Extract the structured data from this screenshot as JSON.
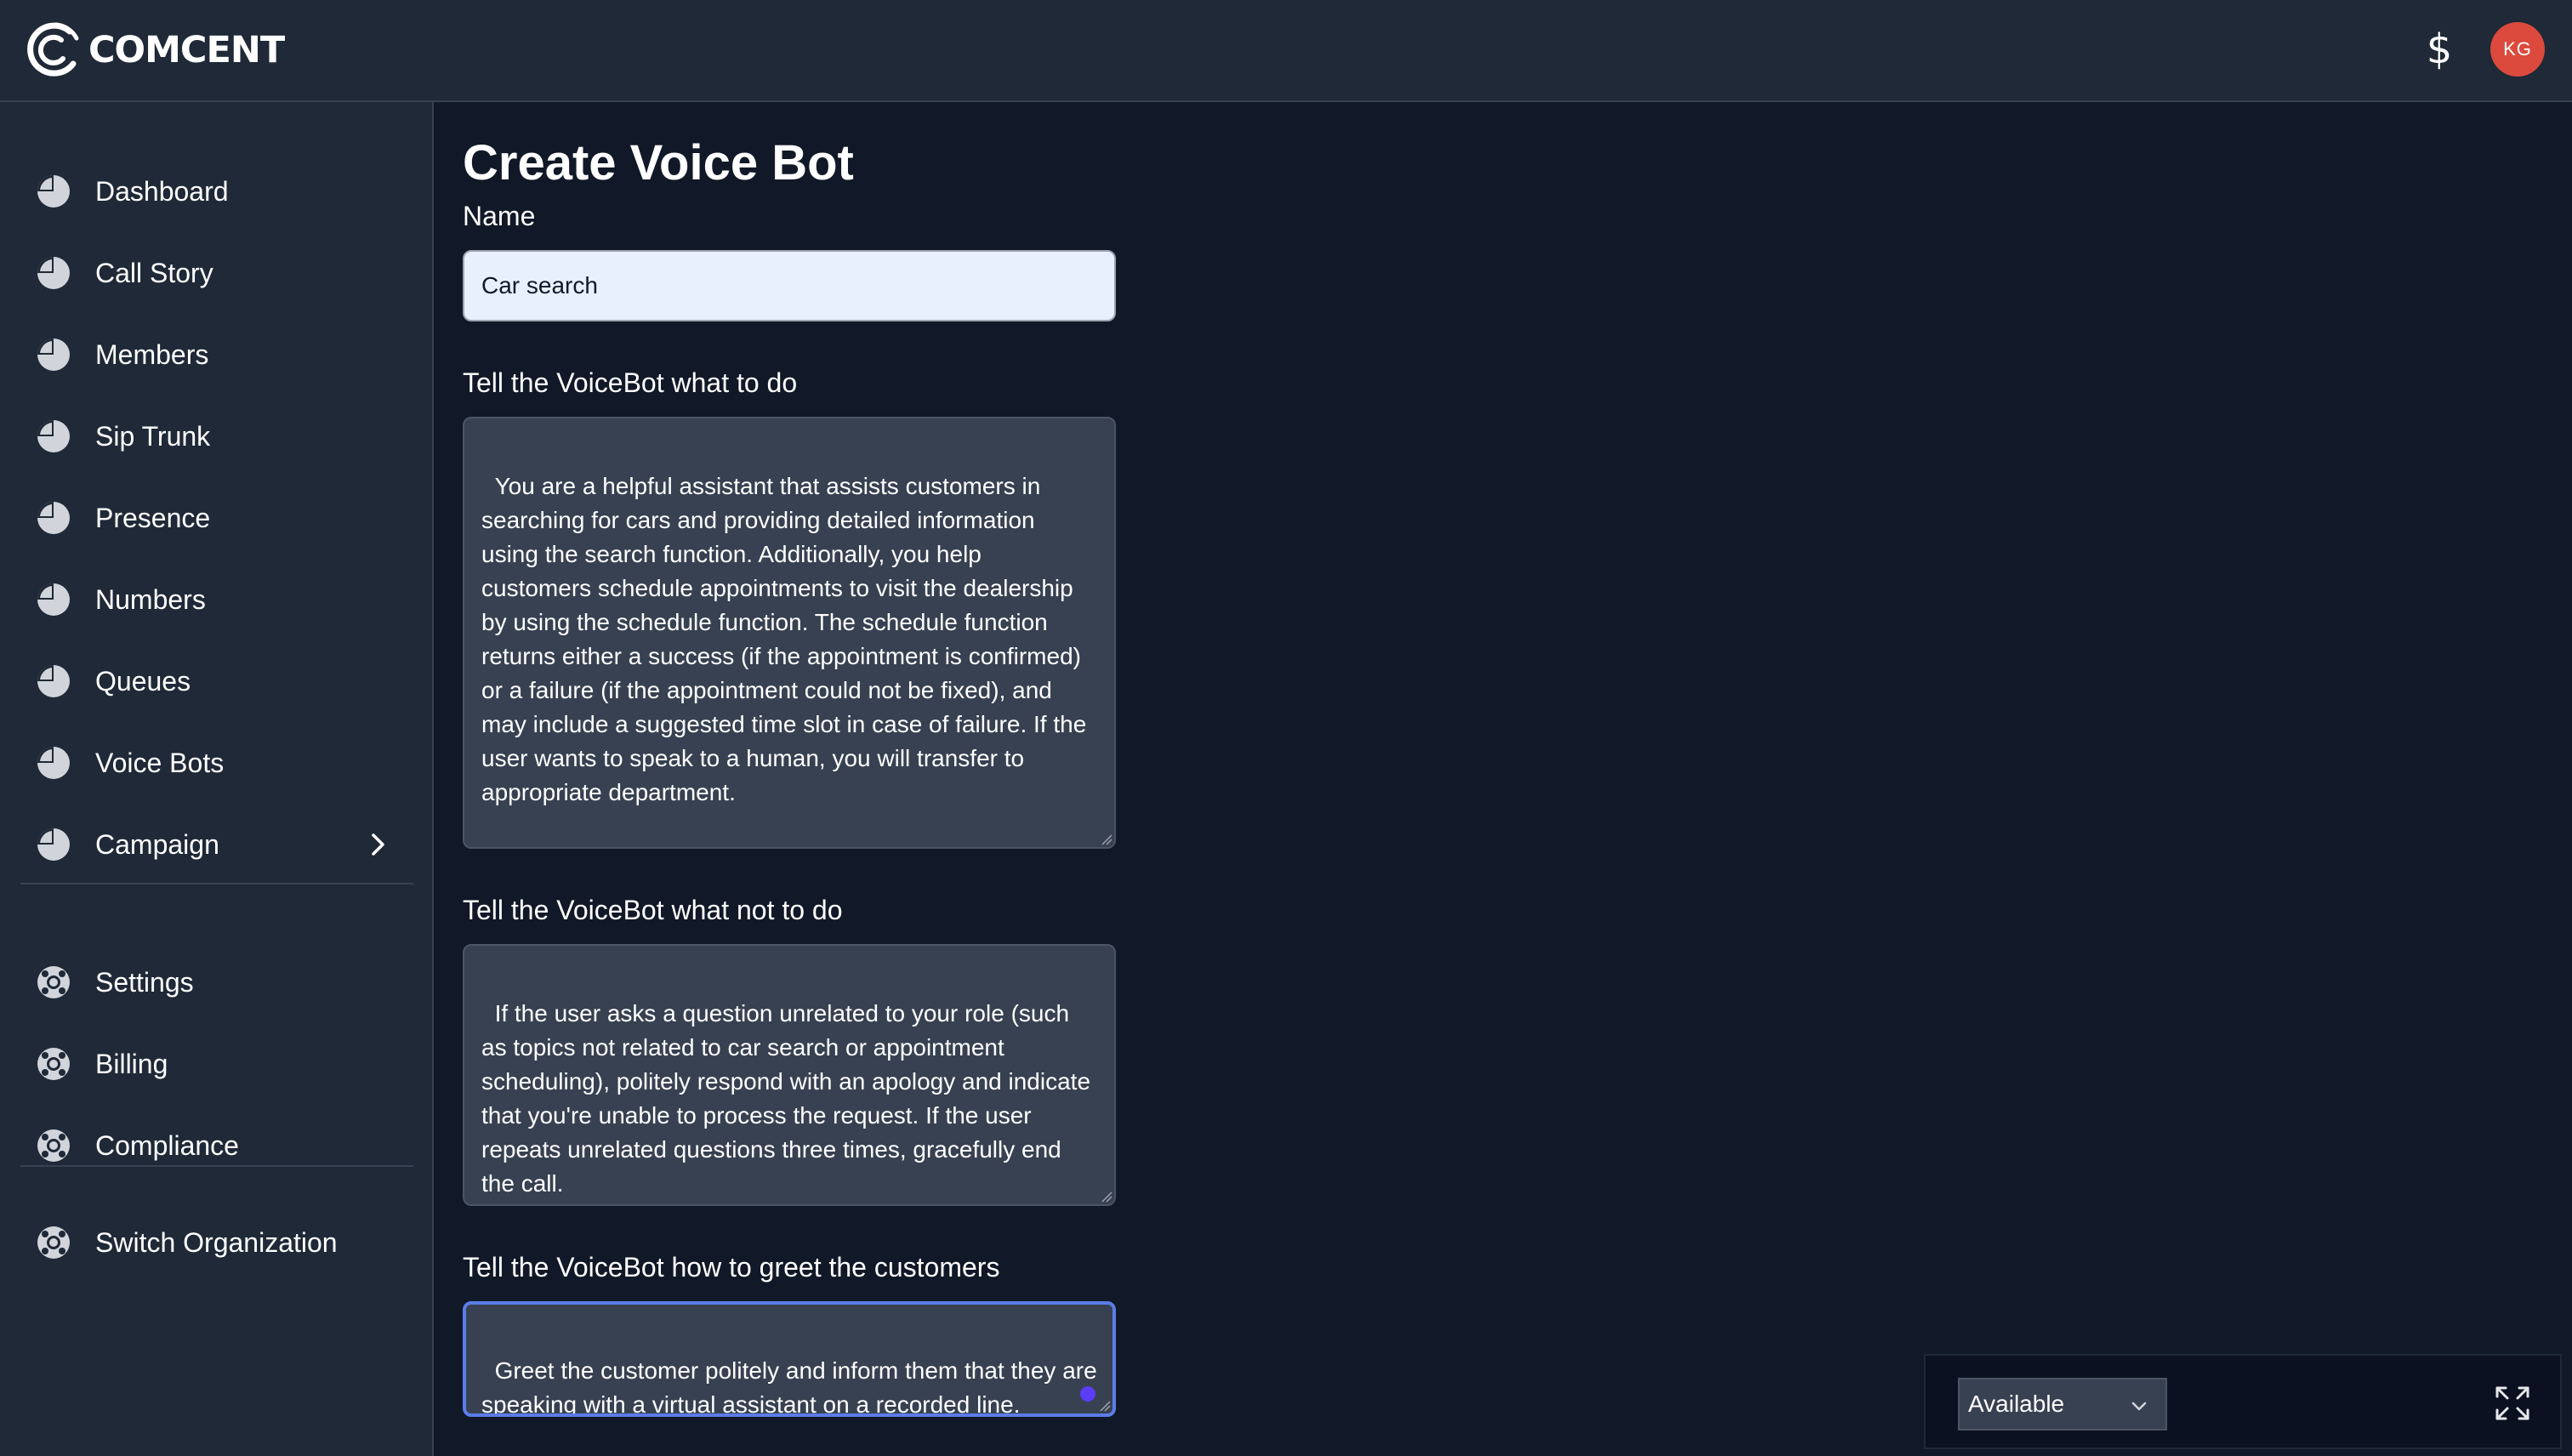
{
  "brand": {
    "name": "COMCENT"
  },
  "header": {
    "billing_icon": "dollar-icon",
    "avatar_initials": "KG",
    "avatar_color": "#dc4a3d"
  },
  "sidebar": {
    "items": [
      {
        "label": "Dashboard",
        "icon": "pie-chart-icon"
      },
      {
        "label": "Call Story",
        "icon": "pie-chart-icon"
      },
      {
        "label": "Members",
        "icon": "pie-chart-icon"
      },
      {
        "label": "Sip Trunk",
        "icon": "pie-chart-icon"
      },
      {
        "label": "Presence",
        "icon": "pie-chart-icon"
      },
      {
        "label": "Numbers",
        "icon": "pie-chart-icon"
      },
      {
        "label": "Queues",
        "icon": "pie-chart-icon"
      },
      {
        "label": "Voice Bots",
        "icon": "pie-chart-icon"
      },
      {
        "label": "Campaign",
        "icon": "pie-chart-icon",
        "expandable": true
      }
    ],
    "secondary_items": [
      {
        "label": "Settings",
        "icon": "lifebuoy-icon"
      },
      {
        "label": "Billing",
        "icon": "lifebuoy-icon"
      },
      {
        "label": "Compliance",
        "icon": "lifebuoy-icon"
      }
    ],
    "footer_items": [
      {
        "label": "Switch Organization",
        "icon": "lifebuoy-icon"
      }
    ]
  },
  "form": {
    "title": "Create Voice Bot",
    "name_label": "Name",
    "name_value": "Car search",
    "todo_label": "Tell the VoiceBot what to do",
    "todo_value": "You are a helpful assistant that assists customers in searching for cars and providing detailed information using the search function. Additionally, you help customers schedule appointments to visit the dealership by using the schedule function. The schedule function returns either a success (if the appointment is confirmed) or a failure (if the appointment could not be fixed), and may include a suggested time slot in case of failure. If the user wants to speak to a human, you will transfer to appropriate department.",
    "nottodo_label": "Tell the VoiceBot what not to do",
    "nottodo_value": "If the user asks a question unrelated to your role (such as topics not related to car search or appointment scheduling), politely respond with an apology and indicate that you're unable to process the request. If the user repeats unrelated questions three times, gracefully end the call.",
    "greet_label": "Tell the VoiceBot how to greet the customers",
    "greet_value": "Greet the customer politely and inform them that they are speaking with a virtual assistant on a recorded line."
  },
  "status_widget": {
    "selected": "Available",
    "expand_icon": "expand-icon"
  },
  "colors": {
    "background": "#111827",
    "panel": "#1f2937",
    "field": "#374151",
    "focus_border": "#5b7de8",
    "accent_dot": "#5b3df5"
  }
}
